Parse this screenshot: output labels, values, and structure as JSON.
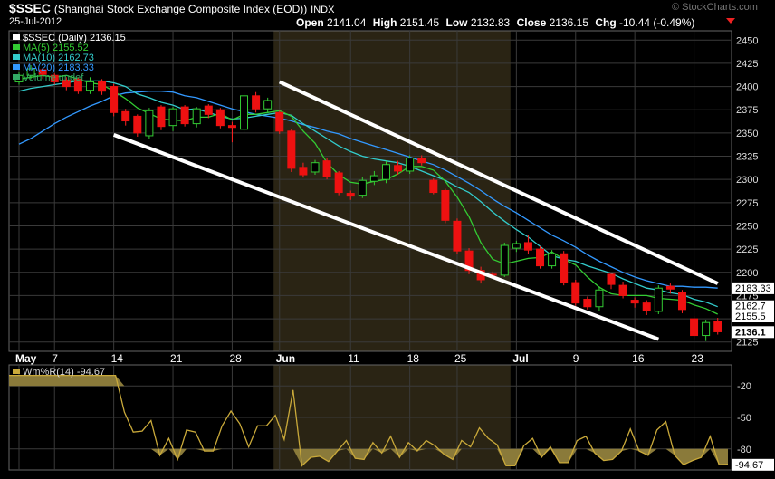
{
  "header": {
    "symbol": "$SSEC",
    "description": "(Shanghai Stock Exchange Composite Index (EOD))",
    "exchange": "INDX",
    "date": "25-Jul-2012",
    "watermark": "© StockCharts.com",
    "open_label": "Open",
    "open": "2141.04",
    "high_label": "High",
    "high": "2151.45",
    "low_label": "Low",
    "low": "2132.83",
    "close_label": "Close",
    "close": "2136.15",
    "chg_label": "Chg",
    "chg": "-10.44 (-0.49%)"
  },
  "legend": [
    {
      "text": "$SSEC (Daily) 2136.15",
      "color": "#ffffff"
    },
    {
      "text": "MA(5) 2155.52",
      "color": "#33cc33"
    },
    {
      "text": "MA(10) 2162.73",
      "color": "#33cccc"
    },
    {
      "text": "MA(20) 2183.33",
      "color": "#3399ff"
    },
    {
      "text": "Volume undef",
      "color": "#33aa66"
    }
  ],
  "value_tags": [
    {
      "text": "2183.33",
      "value": 2183.33,
      "bg": "#ffffff",
      "fg": "#000000"
    },
    {
      "text": "2162.7",
      "value": 2164,
      "bg": "#ffffff",
      "fg": "#000000"
    },
    {
      "text": "2155.5",
      "value": 2153,
      "bg": "#ffffff",
      "fg": "#000000"
    },
    {
      "text": "2136.1",
      "value": 2136.15,
      "bg": "#ffffff",
      "fg": "#000000"
    }
  ],
  "lower_panel": {
    "label": "Wm%R(14) -94.67",
    "last_tag": "-94.67",
    "ylim": [
      -100,
      0
    ],
    "ticks": [
      -20,
      -50,
      -80
    ]
  },
  "chart_data": [
    {
      "type": "candlestick",
      "title": "$SSEC (Daily) 2136.15",
      "ylim": [
        2115,
        2460
      ],
      "y_ticks": [
        2125,
        2150,
        2175,
        2200,
        2225,
        2250,
        2275,
        2300,
        2325,
        2350,
        2375,
        2400,
        2425,
        2450
      ],
      "x_tick_labels": [
        "May",
        "7",
        "14",
        "21",
        "28",
        "Jun",
        "11",
        "18",
        "25",
        "Jul",
        "9",
        "16",
        "23"
      ],
      "dates": [
        "May 2",
        "May 3",
        "May 4",
        "May 7",
        "May 8",
        "May 9",
        "May 10",
        "May 11",
        "May 14",
        "May 15",
        "May 16",
        "May 17",
        "May 18",
        "May 21",
        "May 22",
        "May 23",
        "May 24",
        "May 25",
        "May 28",
        "May 29",
        "May 30",
        "May 31",
        "Jun 1",
        "Jun 4",
        "Jun 5",
        "Jun 6",
        "Jun 7",
        "Jun 8",
        "Jun 11",
        "Jun 12",
        "Jun 13",
        "Jun 14",
        "Jun 15",
        "Jun 18",
        "Jun 19",
        "Jun 20",
        "Jun 21",
        "Jun 25",
        "Jun 26",
        "Jun 27",
        "Jun 28",
        "Jun 29",
        "Jul 2",
        "Jul 3",
        "Jul 4",
        "Jul 5",
        "Jul 6",
        "Jul 9",
        "Jul 10",
        "Jul 11",
        "Jul 12",
        "Jul 13",
        "Jul 16",
        "Jul 17",
        "Jul 18",
        "Jul 19",
        "Jul 20",
        "Jul 23",
        "Jul 24",
        "Jul 25"
      ],
      "open": [
        2405,
        2412,
        2418,
        2412,
        2407,
        2408,
        2396,
        2405,
        2400,
        2373,
        2368,
        2347,
        2378,
        2358,
        2378,
        2360,
        2379,
        2375,
        2358,
        2354,
        2390,
        2376,
        2372,
        2352,
        2313,
        2308,
        2320,
        2307,
        2285,
        2283,
        2298,
        2300,
        2315,
        2309,
        2323,
        2299,
        2288,
        2255,
        2223,
        2202,
        2198,
        2197,
        2226,
        2232,
        2225,
        2207,
        2220,
        2189,
        2171,
        2163,
        2198,
        2186,
        2170,
        2167,
        2158,
        2185,
        2178,
        2150,
        2132,
        2147
      ],
      "close": [
        2412,
        2419,
        2413,
        2405,
        2400,
        2395,
        2405,
        2395,
        2372,
        2363,
        2350,
        2374,
        2357,
        2376,
        2360,
        2376,
        2370,
        2358,
        2356,
        2390,
        2376,
        2385,
        2352,
        2312,
        2305,
        2318,
        2303,
        2286,
        2282,
        2299,
        2304,
        2316,
        2309,
        2323,
        2318,
        2286,
        2256,
        2223,
        2202,
        2192,
        2197,
        2229,
        2231,
        2224,
        2207,
        2220,
        2189,
        2167,
        2163,
        2181,
        2187,
        2175,
        2167,
        2159,
        2183,
        2182,
        2160,
        2132,
        2146,
        2136
      ],
      "high": [
        2416,
        2423,
        2420,
        2414,
        2410,
        2410,
        2410,
        2408,
        2403,
        2376,
        2370,
        2377,
        2380,
        2378,
        2380,
        2378,
        2381,
        2377,
        2362,
        2393,
        2394,
        2388,
        2374,
        2354,
        2318,
        2321,
        2323,
        2309,
        2288,
        2303,
        2309,
        2320,
        2320,
        2326,
        2326,
        2301,
        2290,
        2258,
        2226,
        2206,
        2201,
        2232,
        2234,
        2240,
        2228,
        2224,
        2223,
        2192,
        2174,
        2185,
        2198,
        2190,
        2173,
        2170,
        2186,
        2188,
        2181,
        2153,
        2149,
        2151
      ],
      "low": [
        2402,
        2408,
        2408,
        2402,
        2396,
        2392,
        2392,
        2391,
        2368,
        2358,
        2346,
        2344,
        2353,
        2352,
        2357,
        2356,
        2366,
        2355,
        2340,
        2350,
        2372,
        2372,
        2349,
        2308,
        2302,
        2305,
        2300,
        2283,
        2278,
        2280,
        2294,
        2296,
        2305,
        2306,
        2315,
        2284,
        2253,
        2220,
        2198,
        2188,
        2193,
        2195,
        2222,
        2220,
        2204,
        2204,
        2186,
        2164,
        2160,
        2158,
        2182,
        2172,
        2162,
        2154,
        2155,
        2177,
        2156,
        2128,
        2126,
        2133
      ],
      "ma5": [
        2408,
        2410,
        2412,
        2410,
        2412,
        2408,
        2404,
        2402,
        2395,
        2387,
        2377,
        2371,
        2365,
        2364,
        2363,
        2367,
        2367,
        2371,
        2364,
        2370,
        2370,
        2372,
        2374,
        2368,
        2352,
        2339,
        2318,
        2305,
        2297,
        2295,
        2298,
        2300,
        2306,
        2314,
        2314,
        2310,
        2298,
        2281,
        2260,
        2232,
        2214,
        2209,
        2212,
        2215,
        2216,
        2222,
        2214,
        2208,
        2195,
        2184,
        2177,
        2175,
        2175,
        2175,
        2172,
        2171,
        2170,
        2165,
        2161,
        2155
      ],
      "ma10": [
        2395,
        2398,
        2400,
        2402,
        2404,
        2406,
        2406,
        2406,
        2404,
        2400,
        2392,
        2388,
        2383,
        2380,
        2375,
        2376,
        2372,
        2368,
        2365,
        2366,
        2368,
        2370,
        2372,
        2369,
        2360,
        2352,
        2344,
        2336,
        2330,
        2325,
        2322,
        2320,
        2318,
        2314,
        2309,
        2304,
        2299,
        2292,
        2286,
        2276,
        2265,
        2255,
        2246,
        2238,
        2228,
        2218,
        2214,
        2212,
        2207,
        2203,
        2199,
        2193,
        2188,
        2183,
        2181,
        2178,
        2176,
        2171,
        2168,
        2163
      ],
      "ma20": [
        2338,
        2344,
        2352,
        2360,
        2367,
        2373,
        2379,
        2384,
        2390,
        2393,
        2394,
        2395,
        2395,
        2394,
        2390,
        2388,
        2384,
        2380,
        2376,
        2373,
        2370,
        2368,
        2366,
        2363,
        2359,
        2356,
        2352,
        2349,
        2344,
        2340,
        2336,
        2332,
        2328,
        2324,
        2320,
        2316,
        2310,
        2303,
        2296,
        2288,
        2279,
        2271,
        2264,
        2256,
        2248,
        2240,
        2234,
        2227,
        2219,
        2212,
        2206,
        2200,
        2195,
        2191,
        2188,
        2185,
        2185,
        2184,
        2184,
        2183
      ],
      "trendlines": [
        {
          "from": [
            "Jun 1",
            2405
          ],
          "to": [
            "Jul 25",
            2188
          ]
        },
        {
          "from": [
            "May 14",
            2348
          ],
          "to": [
            "Jul 18",
            2128
          ]
        }
      ]
    },
    {
      "type": "line",
      "title": "Wm%R(14) -94.67",
      "ylim": [
        -100,
        0
      ],
      "values": [
        -10,
        -10,
        -10,
        -10,
        -10,
        -10,
        -10,
        -10,
        -10,
        -10,
        -10,
        -10,
        -10,
        -45,
        -64,
        -63,
        -53,
        -86,
        -70,
        -90,
        -62,
        -64,
        -82,
        -82,
        -58,
        -44,
        -56,
        -78,
        -58,
        -58,
        -48,
        -71,
        -24,
        -96,
        -88,
        -87,
        -92,
        -82,
        -72,
        -89,
        -90,
        -74,
        -84,
        -68,
        -88,
        -74,
        -82,
        -72,
        -77,
        -85,
        -90,
        -72,
        -78,
        -60,
        -70,
        -76,
        -96,
        -96,
        -77,
        -70,
        -88,
        -78,
        -93,
        -93,
        -72,
        -68,
        -84,
        -91,
        -90,
        -82,
        -61,
        -82,
        -86,
        -62,
        -54,
        -86,
        -95,
        -91,
        -88,
        -68,
        -95,
        -94.67
      ]
    }
  ]
}
